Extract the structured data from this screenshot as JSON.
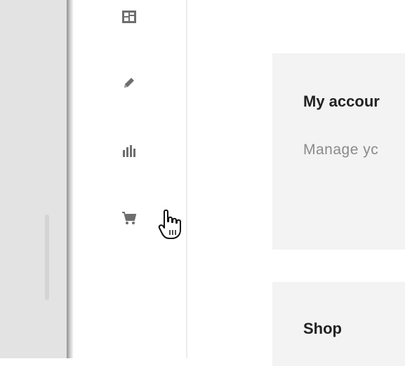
{
  "nav_rail": {
    "icons": [
      {
        "name": "dashboard-icon"
      },
      {
        "name": "edit-icon"
      },
      {
        "name": "bar-chart-icon"
      },
      {
        "name": "cart-icon"
      }
    ]
  },
  "cards": [
    {
      "title": "My accour",
      "description": "Manage yc"
    },
    {
      "title": "Shop"
    }
  ],
  "colors": {
    "card_bg": "#f3f3f3",
    "icon": "#6e6e6e",
    "title": "#222222",
    "description": "#8a8a8a"
  }
}
